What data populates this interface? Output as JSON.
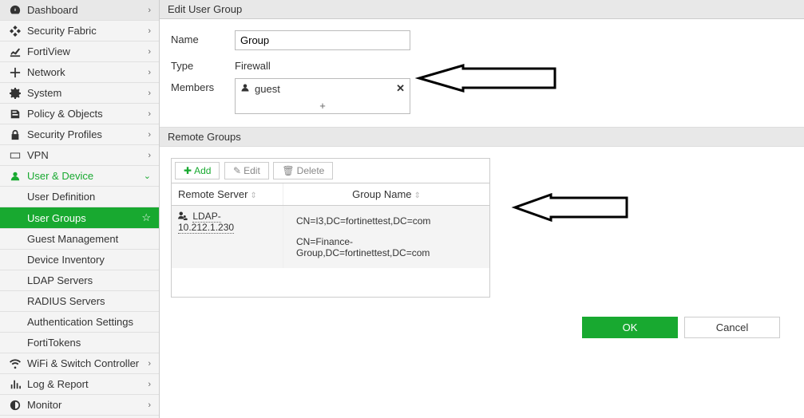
{
  "sidebar": {
    "items": [
      {
        "label": "Dashboard"
      },
      {
        "label": "Security Fabric"
      },
      {
        "label": "FortiView"
      },
      {
        "label": "Network"
      },
      {
        "label": "System"
      },
      {
        "label": "Policy & Objects"
      },
      {
        "label": "Security Profiles"
      },
      {
        "label": "VPN"
      },
      {
        "label": "User & Device"
      },
      {
        "label": "WiFi & Switch Controller"
      },
      {
        "label": "Log & Report"
      },
      {
        "label": "Monitor"
      }
    ],
    "sub": [
      {
        "label": "User Definition"
      },
      {
        "label": "User Groups"
      },
      {
        "label": "Guest Management"
      },
      {
        "label": "Device Inventory"
      },
      {
        "label": "LDAP Servers"
      },
      {
        "label": "RADIUS Servers"
      },
      {
        "label": "Authentication Settings"
      },
      {
        "label": "FortiTokens"
      }
    ]
  },
  "page": {
    "title": "Edit User Group",
    "name_label": "Name",
    "name_value": "Group",
    "type_label": "Type",
    "type_value": "Firewall",
    "members_label": "Members",
    "member_chip": "guest",
    "section_remote": "Remote Groups",
    "toolbar": {
      "add": "Add",
      "edit": "Edit",
      "delete": "Delete"
    },
    "cols": {
      "server": "Remote Server",
      "group": "Group Name"
    },
    "row": {
      "server": "LDAP-10.212.1.230",
      "g1": "CN=I3,DC=fortinettest,DC=com",
      "g2": "CN=Finance-Group,DC=fortinettest,DC=com"
    },
    "ok": "OK",
    "cancel": "Cancel"
  }
}
